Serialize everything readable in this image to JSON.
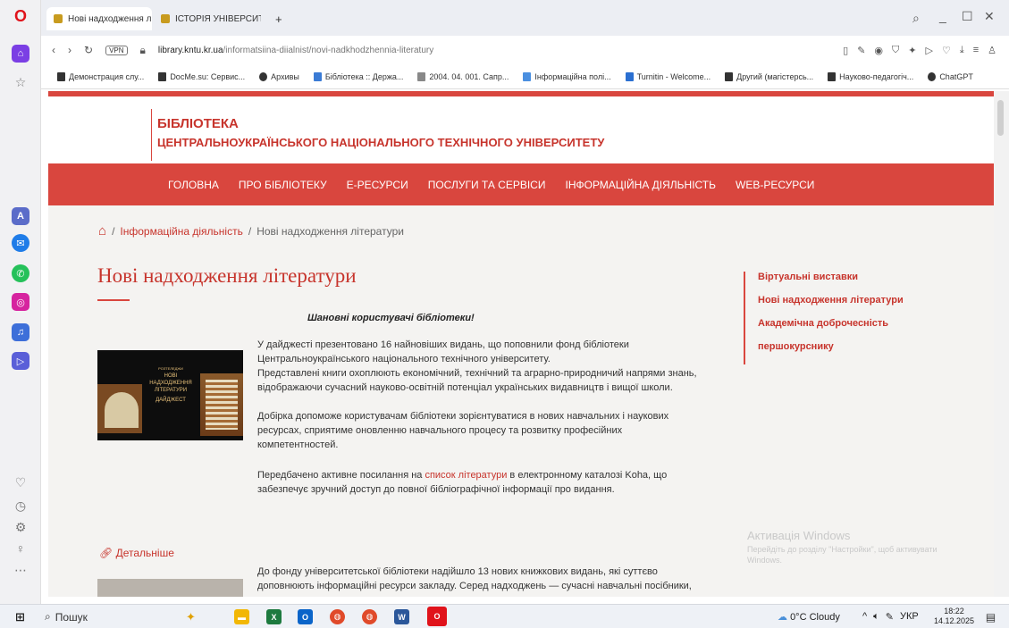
{
  "browser": {
    "tabs": [
      {
        "label": "Нові надходження літер..."
      },
      {
        "label": "ІСТОРІЯ УНІВЕРСИТЕТУ"
      }
    ],
    "new_tab": "+",
    "url_domain": "library.kntu.kr.ua",
    "url_path": "/informatsiina-diialnist/novi-nadkhodzhennia-literatury",
    "vpn_label": "VPN",
    "bookmarks": [
      {
        "label": "Демонстрация слу..."
      },
      {
        "label": "DocMe.su: Сервис..."
      },
      {
        "label": "Архивы"
      },
      {
        "label": "Бібліотека :: Держа..."
      },
      {
        "label": "2004. 04. 001. Сапр..."
      },
      {
        "label": "Інформаційна полі..."
      },
      {
        "label": "Turnitin - Welcome..."
      },
      {
        "label": "Другий (магістерсь..."
      },
      {
        "label": "Науково-педагогіч..."
      },
      {
        "label": "ChatGPT"
      }
    ]
  },
  "site": {
    "title_line1": "БІБЛІОТЕКА",
    "title_line2": "ЦЕНТРАЛЬНОУКРАЇНСЬКОГО НАЦІОНАЛЬНОГО ТЕХНІЧНОГО УНІВЕРСИТЕТУ",
    "nav": [
      {
        "label": "ГОЛОВНА"
      },
      {
        "label": "ПРО БІБЛІОТЕКУ"
      },
      {
        "label": "Е-РЕСУРСИ"
      },
      {
        "label": "ПОСЛУГИ ТА СЕРВІСИ"
      },
      {
        "label": "ІНФОРМАЦІЙНА ДІЯЛЬНІСТЬ"
      },
      {
        "label": "WEB-РЕСУРСИ"
      }
    ]
  },
  "breadcrumb": {
    "sep": "/",
    "section": "Інформаційна діяльність",
    "current": "Нові надходження літератури"
  },
  "article": {
    "title": "Нові надходження літератури",
    "greeting": "Шановні користувачі бібліотеки!",
    "cover_lines": [
      "РОЗТЕЛЕДЖИ",
      "НОВІ",
      "НАДХОДЖЕННЯ",
      "ЛІТЕРАТУРИ",
      "ДАЙДЖЕСТ"
    ],
    "p1": "У дайджесті презентовано 16 найновіших видань, що поповнили фонд бібліотеки Центральноукраїнського національного технічного університету.",
    "p2": "Представлені книги охоплюють економічний, технічний та аграрно-природничий напрями знань, відображаючи сучасний науково-освітній потенціал українських видавництв і вищої школи.",
    "p3": "Добірка допоможе користувачам бібліотеки зорієнтуватися в нових навчальних і наукових ресурсах, сприятиме оновленню навчального процесу та розвитку професійних компетентностей.",
    "p4_before": "Передбачено активне посилання на ",
    "p4_link": "список літератури",
    "p4_after": " в електронному каталозі Koha, що забезпечує зручний доступ до повної бібліографічної інформації про видання.",
    "more": "Детальніше",
    "p5": "До фонду університетської бібліотеки надійшло 13 нових книжкових видань, які суттєво доповнюють інформаційні ресурси закладу. Серед надходжень — сучасні навчальні посібники,"
  },
  "sidebar_links": [
    {
      "label": "Віртуальні виставки"
    },
    {
      "label": "Нові надходження літератури"
    },
    {
      "label": "Академічна доброчесність"
    },
    {
      "label": "першокурснику"
    }
  ],
  "activation": {
    "title": "Активація Windows",
    "text": "Перейдіть до розділу \"Настройки\", щоб активувати Windows."
  },
  "taskbar": {
    "search": "Пошук",
    "weather": "0°C Cloudy",
    "lang": "УКР",
    "time": "18:22",
    "date": "14.12.2025"
  }
}
